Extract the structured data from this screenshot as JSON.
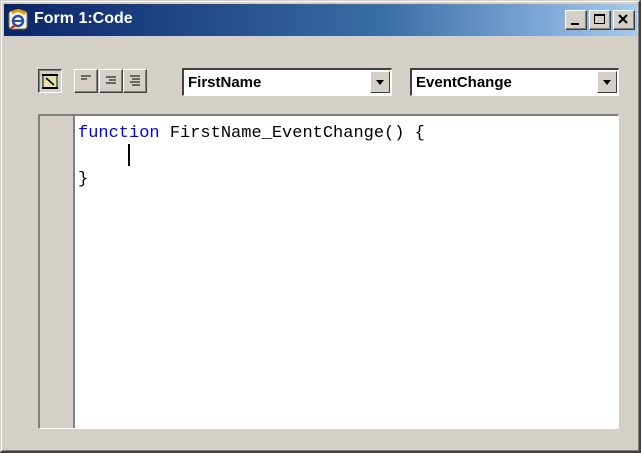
{
  "window": {
    "title": "Form 1:Code",
    "controls": {
      "minimize_icon": "minimize-icon",
      "maximize_icon": "maximize-icon",
      "close_icon": "close-icon"
    }
  },
  "toolbar": {
    "buttons": [
      {
        "icon": "scroll-icon",
        "pressed": true
      },
      {
        "icon": "align-left-icon",
        "pressed": false
      },
      {
        "icon": "align-right-icon",
        "pressed": false
      },
      {
        "icon": "align-justify-icon",
        "pressed": false
      }
    ],
    "object_select": {
      "value": "FirstName"
    },
    "event_select": {
      "value": "EventChange"
    }
  },
  "editor": {
    "lines": [
      {
        "keyword": "function",
        "rest": " FirstName_EventChange() {"
      },
      {
        "keyword": "",
        "rest": ""
      },
      {
        "keyword": "",
        "rest": "}"
      }
    ]
  },
  "colors": {
    "keyword": "#0000ff",
    "title_gradient_start": "#0a246a",
    "title_gradient_end": "#a6caf0",
    "chrome": "#d4d0c8"
  }
}
